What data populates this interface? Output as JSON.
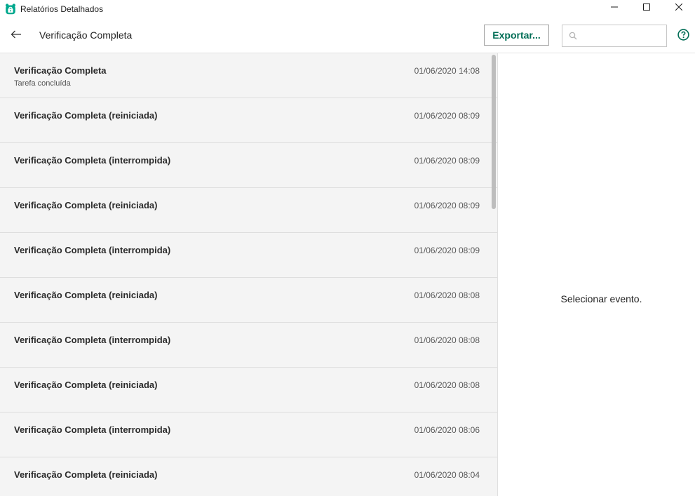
{
  "window": {
    "title": "Relatórios Detalhados"
  },
  "toolbar": {
    "page_title": "Verificação Completa",
    "export_label": "Exportar...",
    "search_value": "",
    "search_placeholder": ""
  },
  "events": [
    {
      "name": "Verificação Completa",
      "subtitle": "Tarefa concluída",
      "date": "01/06/2020 14:08"
    },
    {
      "name": "Verificação Completa (reiniciada)",
      "date": "01/06/2020 08:09"
    },
    {
      "name": "Verificação Completa (interrompida)",
      "date": "01/06/2020 08:09"
    },
    {
      "name": "Verificação Completa (reiniciada)",
      "date": "01/06/2020 08:09"
    },
    {
      "name": "Verificação Completa (interrompida)",
      "date": "01/06/2020 08:09"
    },
    {
      "name": "Verificação Completa (reiniciada)",
      "date": "01/06/2020 08:08"
    },
    {
      "name": "Verificação Completa (interrompida)",
      "date": "01/06/2020 08:08"
    },
    {
      "name": "Verificação Completa (reiniciada)",
      "date": "01/06/2020 08:08"
    },
    {
      "name": "Verificação Completa (interrompida)",
      "date": "01/06/2020 08:06"
    },
    {
      "name": "Verificação Completa (reiniciada)",
      "date": "01/06/2020 08:04"
    }
  ],
  "detail": {
    "placeholder": "Selecionar evento."
  },
  "icons": {
    "app_logo": "kaspersky-bear-icon",
    "back": "arrow-left-icon",
    "search": "search-icon",
    "help": "help-circle-icon",
    "minimize": "minimize-icon",
    "maximize": "maximize-icon",
    "close": "close-icon"
  },
  "colors": {
    "accent": "#006d55",
    "logo": "#00a88e",
    "list_background": "#f4f4f4"
  }
}
